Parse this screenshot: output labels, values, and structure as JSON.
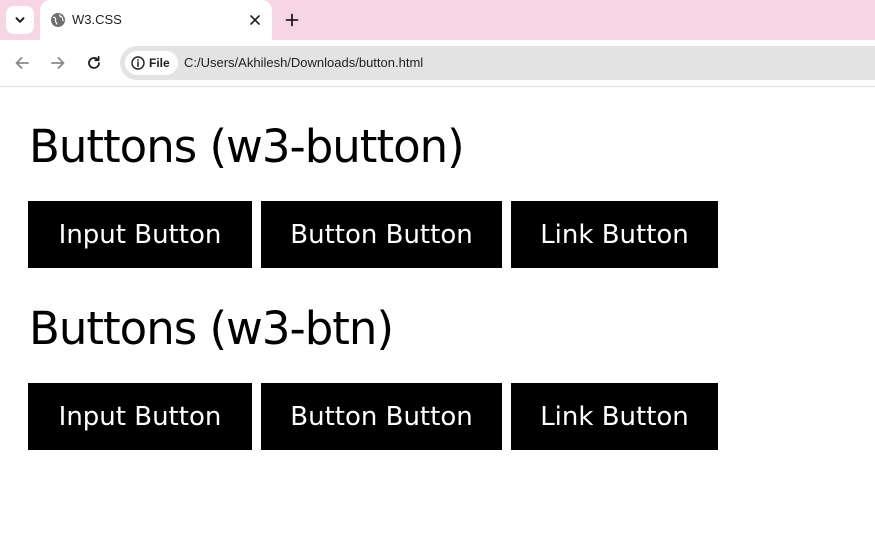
{
  "browser": {
    "tab": {
      "title": "W3.CSS"
    },
    "address_bar": {
      "scheme_chip": "File",
      "url": "C:/Users/Akhilesh/Downloads/button.html"
    },
    "colors": {
      "tabstrip": "#f6d6e4"
    }
  },
  "page": {
    "sections": [
      {
        "heading": "Buttons (w3-button)",
        "buttons": {
          "input": "Input Button",
          "button": "Button Button",
          "link": "Link Button"
        }
      },
      {
        "heading": "Buttons (w3-btn)",
        "buttons": {
          "input": "Input Button",
          "button": "Button Button",
          "link": "Link Button"
        }
      }
    ],
    "colors": {
      "button_bg": "#000000",
      "button_text": "#ffffff"
    }
  }
}
